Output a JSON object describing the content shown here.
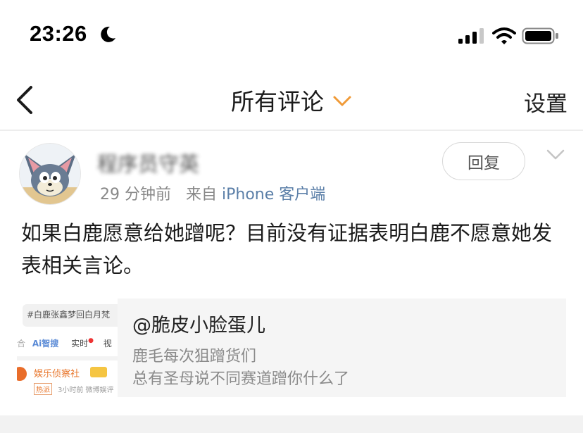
{
  "status_bar": {
    "time": "23:26"
  },
  "nav": {
    "title": "所有评论",
    "settings_label": "设置"
  },
  "comment": {
    "username": "程序员守英",
    "time_ago": "29 分钟前",
    "source_prefix": "来自",
    "source": "iPhone 客户端",
    "reply_label": "回复",
    "text": "如果白鹿愿意给她蹭呢？目前没有证据表明白鹿不愿意她发表相关言论。"
  },
  "card": {
    "title": "@脆皮小脸蛋儿",
    "line1": "鹿毛每次狙蹭货们",
    "line2": "总有圣母说不同赛道蹭你什么了",
    "thumb": {
      "hashtag": "#白鹿张鑫梦回白月梵",
      "tab_ai": "Ai智搜",
      "tab_live": "实时",
      "tab_cut": "视",
      "account": "娱乐侦察社",
      "badge": "热派",
      "meta": "3小时前 微博娱评"
    }
  },
  "colors": {
    "accent": "#f09a37",
    "source_link": "#5b7fa8",
    "meta_gray": "#888888"
  }
}
